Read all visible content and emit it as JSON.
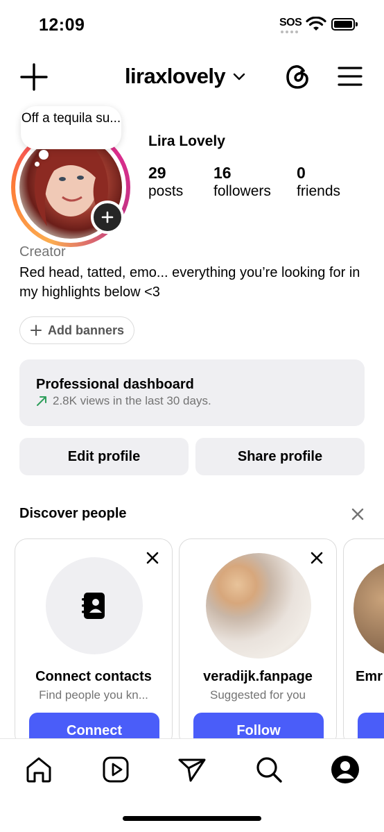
{
  "status_bar": {
    "time": "12:09",
    "sos": "SOS"
  },
  "header": {
    "username": "liraxlovely"
  },
  "profile": {
    "note": "Off a tequila su...",
    "display_name": "Lira Lovely",
    "stats": [
      {
        "value": "29",
        "label": "posts"
      },
      {
        "value": "16",
        "label": "followers"
      },
      {
        "value": "0",
        "label": "friends"
      }
    ],
    "category": "Creator",
    "bio": "Red head, tatted, emo... everything you’re looking for in my highlights below <3",
    "add_banners_label": "Add banners"
  },
  "dashboard": {
    "title": "Professional dashboard",
    "subtitle": "2.8K views in the last 30 days."
  },
  "actions": {
    "edit_label": "Edit profile",
    "share_label": "Share profile"
  },
  "discover": {
    "title": "Discover people",
    "cards": [
      {
        "name": "Connect contacts",
        "subtitle": "Find people you kn...",
        "button": "Connect"
      },
      {
        "name": "veradijk.fanpage",
        "subtitle": "Suggested for you",
        "button": "Follow"
      },
      {
        "name": "Emr",
        "subtitle": "",
        "button": ""
      }
    ]
  },
  "colors": {
    "accent": "#4a5df9",
    "secondary_text": "#737373",
    "surface": "#efeff2",
    "trend_up": "#2e9e5b"
  },
  "icons": {
    "header": [
      "plus-icon",
      "chevron-down-icon",
      "threads-icon",
      "menu-icon"
    ],
    "nav": [
      "home-icon",
      "reels-icon",
      "send-icon",
      "search-icon",
      "profile-icon"
    ]
  }
}
